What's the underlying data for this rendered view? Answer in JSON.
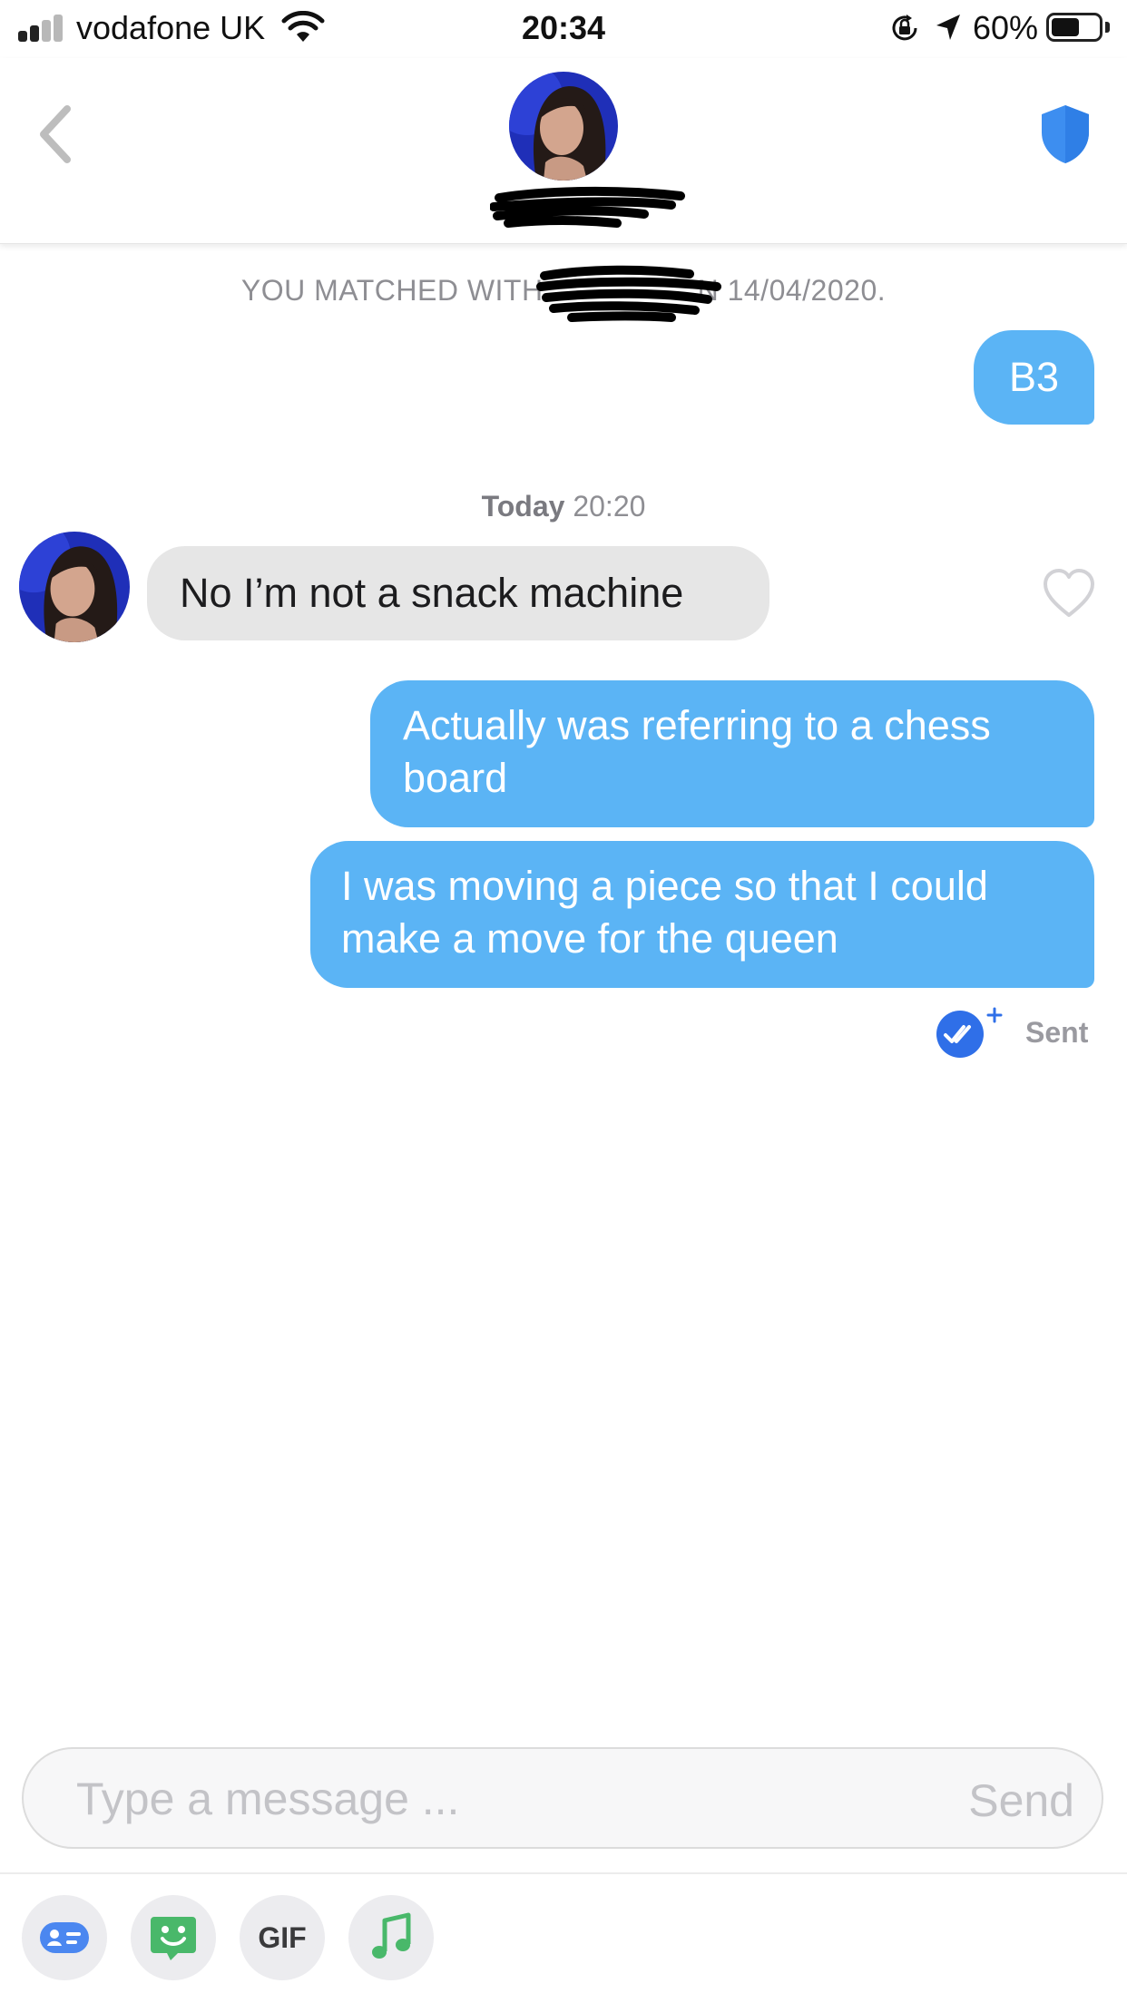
{
  "status_bar": {
    "carrier": "vodafone UK",
    "time": "20:34",
    "battery_percent": "60%",
    "battery_level": 0.6,
    "icons": [
      "signal-icon",
      "wifi-icon",
      "rotation-lock-icon",
      "location-icon",
      "battery-icon"
    ]
  },
  "header": {
    "back_icon": "chevron-left-icon",
    "safety_icon": "shield-icon",
    "name_redacted": true
  },
  "chat": {
    "match_text_prefix": "YOU MATCHED WITH",
    "match_text_suffix": "N 14/04/2020.",
    "day_label": "Today",
    "day_time": "20:20",
    "messages": [
      {
        "from": "me",
        "text": "B3"
      },
      {
        "from": "them",
        "text": "No I’m not a snack machine"
      },
      {
        "from": "me",
        "text": "Actually was referring to a chess board"
      },
      {
        "from": "me",
        "text": "I was moving a piece so that I could make a move for the queen"
      }
    ],
    "status": "Sent"
  },
  "composer": {
    "placeholder": "Type a message ...",
    "send_label": "Send"
  },
  "toolbar": {
    "gif_label": "GIF",
    "items": [
      "contact-card-icon",
      "sticker-icon",
      "gif-button",
      "music-icon"
    ]
  },
  "colors": {
    "outgoing_bubble": "#5bb4f5",
    "incoming_bubble": "#e6e6e6",
    "shield": "#3d8ef0",
    "read_receipt": "#2f6fe8"
  }
}
